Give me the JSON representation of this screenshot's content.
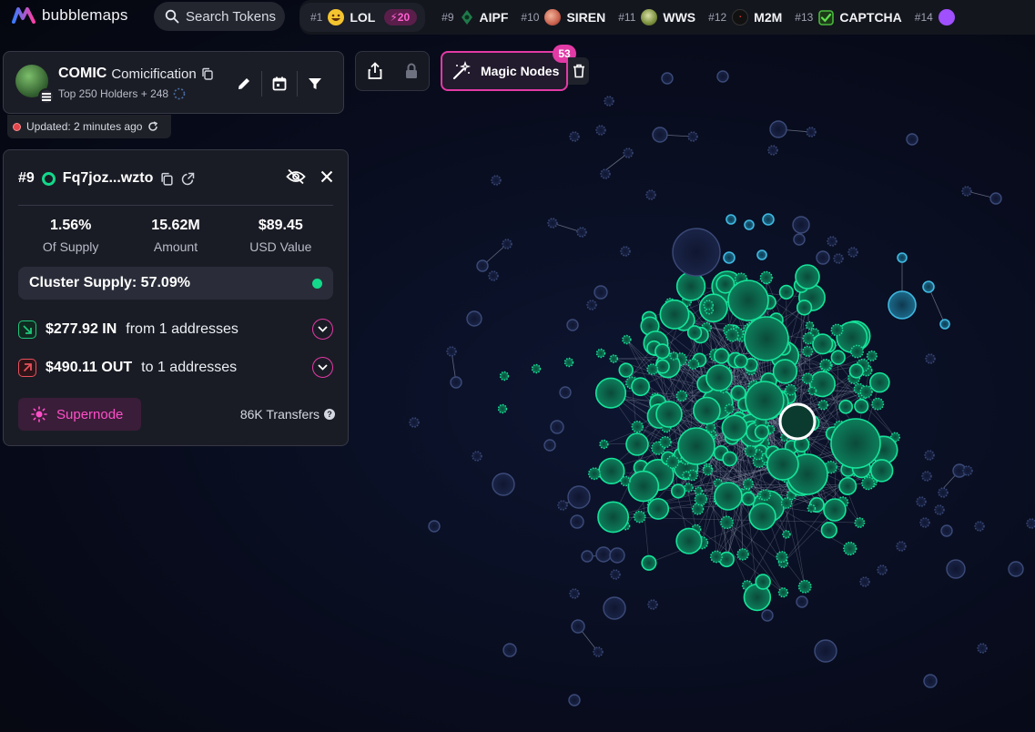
{
  "brand": {
    "name": "bubblemaps"
  },
  "search": {
    "label": "Search Tokens"
  },
  "ticker": [
    {
      "rank": "#1",
      "symbol": "LOL",
      "badge": "20",
      "icon_color": "#f4c430",
      "icon": "grin-face-icon"
    },
    {
      "rank": "#9",
      "symbol": "AIPF",
      "icon_color": "#1f7a4a",
      "icon": "aipf-token-icon"
    },
    {
      "rank": "#10",
      "symbol": "SIREN",
      "icon_color": "#c9614d",
      "icon": "siren-token-icon"
    },
    {
      "rank": "#11",
      "symbol": "WWS",
      "icon_color": "#7a8f3d",
      "icon": "wws-token-icon"
    },
    {
      "rank": "#12",
      "symbol": "M2M",
      "icon_color": "#111111",
      "icon": "m2m-token-icon"
    },
    {
      "rank": "#13",
      "symbol": "CAPTCHA",
      "icon_color": "#48b83c",
      "icon": "checkbox-token-icon"
    },
    {
      "rank": "#14",
      "symbol": "",
      "icon_color": "#a050ff",
      "icon": "token-icon"
    }
  ],
  "token": {
    "symbol": "COMIC",
    "name": "Comicification",
    "subtitle": "Top 250 Holders + 248",
    "updated": "Updated: 2 minutes ago"
  },
  "magic_nodes": {
    "label": "Magic Nodes",
    "count": "53"
  },
  "wallet": {
    "rank": "#9",
    "address": "Fq7joz...wzto",
    "stats": [
      {
        "value": "1.56%",
        "label": "Of Supply"
      },
      {
        "value": "15.62M",
        "label": "Amount"
      },
      {
        "value": "$89.45",
        "label": "USD Value"
      }
    ],
    "cluster_supply": "Cluster Supply: 57.09%",
    "inflow": {
      "amount": "$277.92 IN",
      "detail": "from 1 addresses"
    },
    "outflow": {
      "amount": "$490.11 OUT",
      "detail": "to 1 addresses"
    },
    "supernode_label": "Supernode",
    "transfers": "86K Transfers"
  },
  "colors": {
    "accent_pink": "#e23aa5",
    "cluster_green": "#13d98b",
    "node_blue": "#4aa3c8",
    "node_grey": "#39456a",
    "in_green": "#20c77a",
    "out_red": "#e8505b"
  }
}
